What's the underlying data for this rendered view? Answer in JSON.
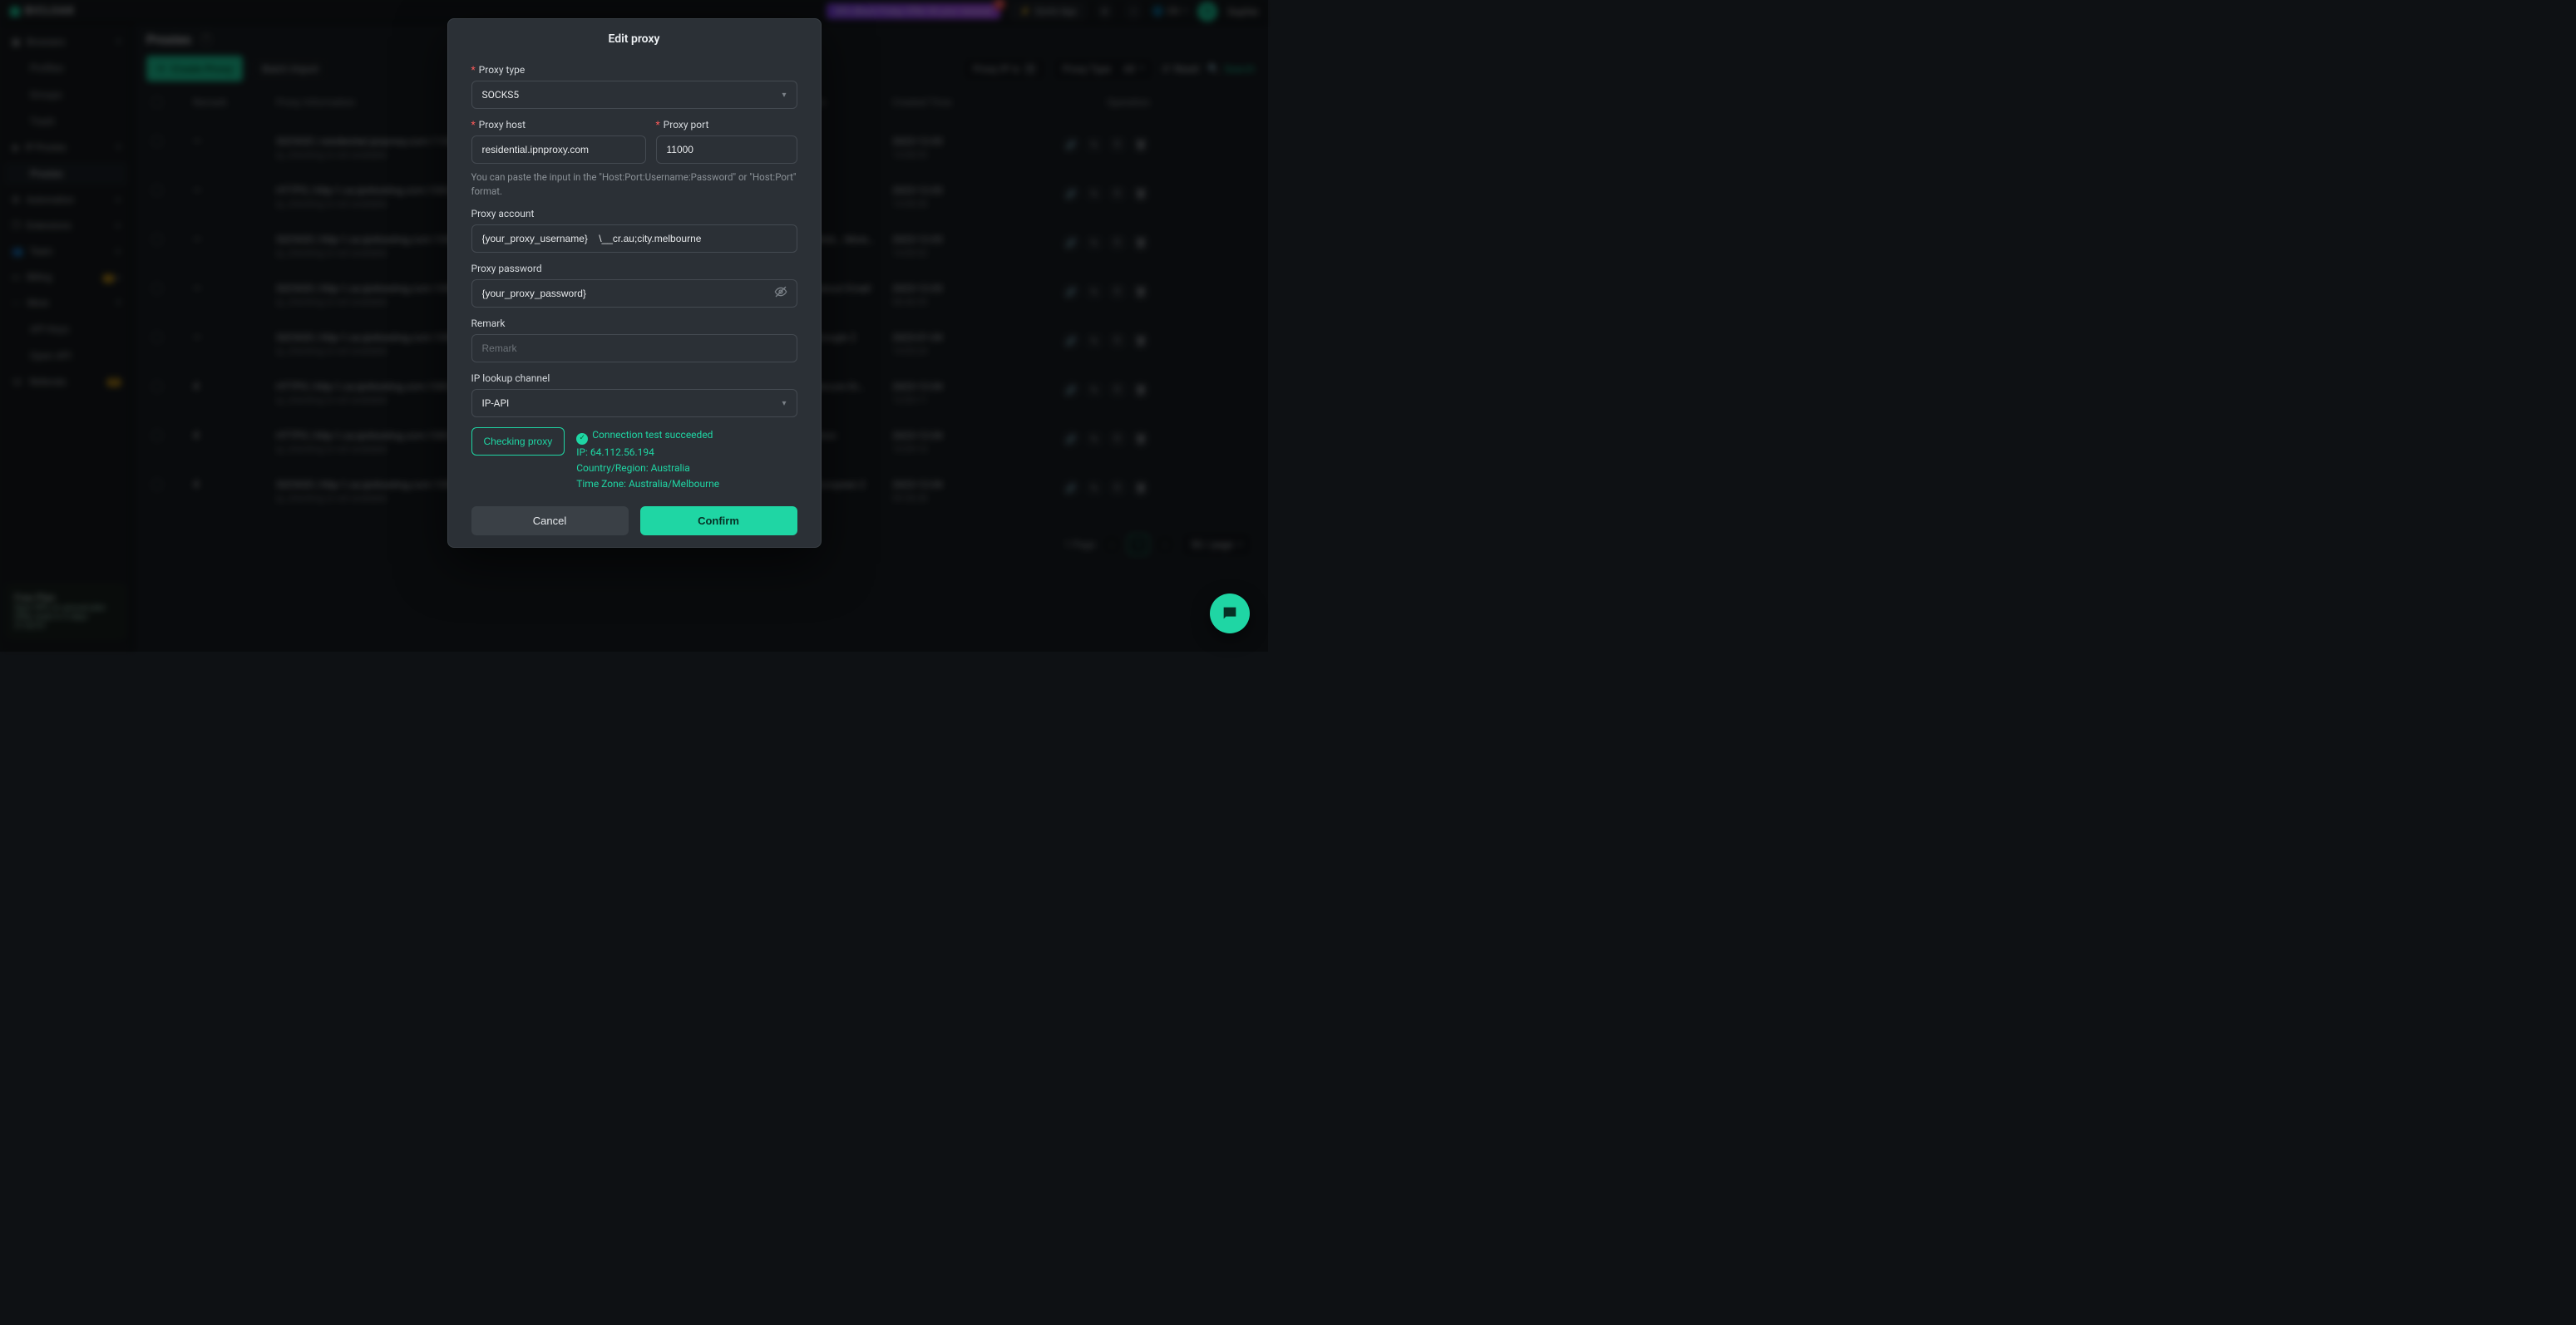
{
  "brand": "BICLOAK",
  "topbar": {
    "promo": "50% Black Friday Offer till your renewal",
    "quick_app": "Quick App",
    "lang": "EN",
    "username": "Sophie",
    "avatar_initial": "S"
  },
  "sidebar": {
    "sections": [
      {
        "icon": "grid",
        "label": "Browsers",
        "items": [
          "Profiles",
          "Groups",
          "Trash"
        ]
      },
      {
        "icon": "shield",
        "label": "IP Proxies",
        "items": [
          "Proxies"
        ],
        "active_item": "Proxies"
      },
      {
        "icon": "robot",
        "label": "Automation",
        "items": []
      },
      {
        "icon": "link",
        "label": "Extensions",
        "items": []
      },
      {
        "icon": "users",
        "label": "Team",
        "items": []
      },
      {
        "icon": "card",
        "label": "Billing",
        "items": [],
        "badge": "1"
      },
      {
        "icon": "more",
        "label": "More",
        "items": [
          "API Keys",
          "Open API"
        ]
      },
      {
        "icon": "headset",
        "label": "Referrals",
        "items": [],
        "badge": "★"
      }
    ],
    "footer_title": "Free Plan",
    "footer_line1": "Save 50% on annual plan",
    "footer_line2": "Offer ends in 5 days 21:03:51"
  },
  "page": {
    "title": "Proxies",
    "create": "Create Proxy",
    "batch": "Batch Import",
    "filters": {
      "ip_label": "Proxy IP is",
      "ip_chip": "×",
      "type_label": "Proxy Type",
      "type_all": "All"
    },
    "reset": "Reset",
    "search": "Search"
  },
  "table": {
    "columns": [
      "",
      "Remark",
      "Proxy Information",
      "Usage profile",
      "Created Time",
      "Operation"
    ],
    "rows": [
      {
        "remark": "—",
        "title": "SOCKS5 | residential.ipnproxy.com:11000",
        "sub": "ip_checking is not available",
        "usage": "",
        "created": "2023-12-03 14:08:55"
      },
      {
        "remark": "—",
        "title": "HTTPS | http-1.ca.ipnhosting.com:1080",
        "sub": "ip_checking is not available",
        "usage": "",
        "created": "2023-12-03 14:08:38"
      },
      {
        "remark": "—",
        "title": "SOCKS5 | http-1.ca.ipnhosting.com:1080",
        "sub": "ip_checking is not available",
        "usage": "WhatsApp Web… More…",
        "usage_new": "New",
        "created": "2023-12-03 14:00:52"
      },
      {
        "remark": "—",
        "title": "SOCKS5 | http-1.ca.ipnhosting.com:1080",
        "sub": "ip_checking is not available",
        "usage": "Something about Email",
        "created": "2023-12-03 08:46:55"
      },
      {
        "remark": "—",
        "title": "SOCKS5 | http-1.ca.ipnhosting.com:1080",
        "sub": "ip_checking is not available",
        "usage": "Google 2… Google 2",
        "created": "2023-01-04 14:05:24"
      },
      {
        "remark": "4",
        "title": "HTTPS | http-1.ca.ipnhosting.com:1080",
        "sub": "ip_checking is not available",
        "usage": "ChatGPT… Secure Dr…",
        "usage_new": "New",
        "created": "2023-12-04 12:03:11"
      },
      {
        "remark": "4",
        "title": "HTTPS | http-1.ca.ipnhosting.com:1080",
        "sub": "ip_checking is not available",
        "usage": "devices section",
        "created": "2023-12-04 10:09:10"
      },
      {
        "remark": "4",
        "title": "SOCKS5 | http-1.ca.ipnhosting.com:1080",
        "sub": "ip_checking is not available",
        "usage": "Pocket 2… European 2",
        "usage_new": "New",
        "created": "2023-12-04 09:58:38"
      }
    ],
    "pagination": {
      "total": "1 Page",
      "current": "1",
      "size": "50 / page"
    }
  },
  "modal": {
    "title": "Edit proxy",
    "labels": {
      "type": "Proxy type",
      "host": "Proxy host",
      "port": "Proxy port",
      "account": "Proxy account",
      "password": "Proxy password",
      "remark": "Remark",
      "lookup": "IP lookup channel"
    },
    "values": {
      "type": "SOCKS5",
      "host": "residential.ipnproxy.com",
      "port": "11000",
      "account": "{your_proxy_username}    \\__cr.au;city.melbourne",
      "password": "{your_proxy_password}",
      "remark_placeholder": "Remark",
      "lookup": "IP-API"
    },
    "hint": "You can paste the input in the \"Host:Port:Username:Password\" or \"Host:Port\" format.",
    "check_btn": "Checking proxy",
    "result": {
      "ok": "Connection test succeeded",
      "ip": "IP: 64.112.56.194",
      "country": "Country/Region: Australia",
      "tz": "Time Zone: Australia/Melbourne"
    },
    "cancel": "Cancel",
    "confirm": "Confirm"
  }
}
